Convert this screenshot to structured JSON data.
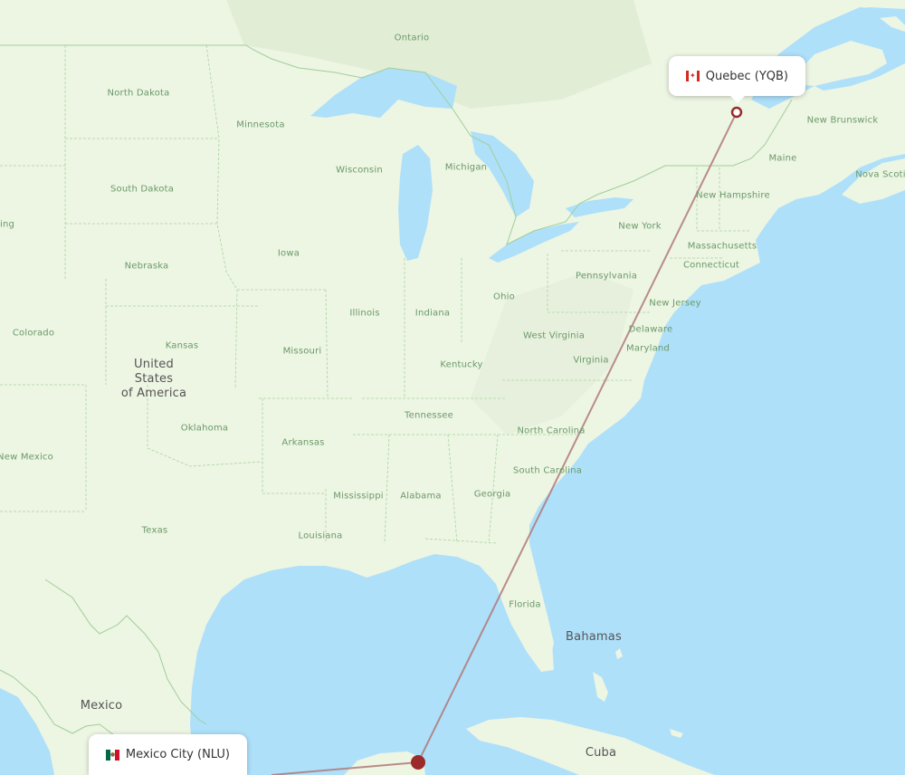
{
  "map": {
    "colors": {
      "water": "#aee0fa",
      "land": "#edf5e3",
      "land_dark": "#e2edd6",
      "border": "#9fcf9a",
      "route": "#b07a7a",
      "marker": "#9b2a2a"
    },
    "labels": {
      "countries": [
        {
          "text": "United States of America",
          "lines": [
            "United",
            "States",
            "of America"
          ]
        },
        {
          "text": "Mexico"
        },
        {
          "text": "Bahamas"
        },
        {
          "text": "Cuba"
        }
      ],
      "regions": [
        "Ontario",
        "North Dakota",
        "Minnesota",
        "Wisconsin",
        "Michigan",
        "South Dakota",
        "Iowa",
        "Nebraska",
        "Colorado",
        "Kansas",
        "Missouri",
        "Illinois",
        "Indiana",
        "Ohio",
        "Kentucky",
        "Oklahoma",
        "Arkansas",
        "Tennessee",
        "New Mexico",
        "Texas",
        "Mississippi",
        "Alabama",
        "Georgia",
        "Louisiana",
        "Florida",
        "South Carolina",
        "North Carolina",
        "Virginia",
        "West Virginia",
        "Maryland",
        "Delaware",
        "New Jersey",
        "Pennsylvania",
        "New York",
        "Connecticut",
        "Massachusetts",
        "New Hampshire",
        "Maine",
        "New Brunswick",
        "Nova Scoti",
        "ing"
      ]
    }
  },
  "route": {
    "origin": {
      "city": "Quebec",
      "code": "YQB",
      "label": "Quebec (YQB)",
      "country": "Canada",
      "flag": "canada-flag"
    },
    "destination": {
      "city": "Mexico City",
      "code": "NLU",
      "label": "Mexico City (NLU)",
      "country": "Mexico",
      "flag": "mexico-flag"
    }
  }
}
